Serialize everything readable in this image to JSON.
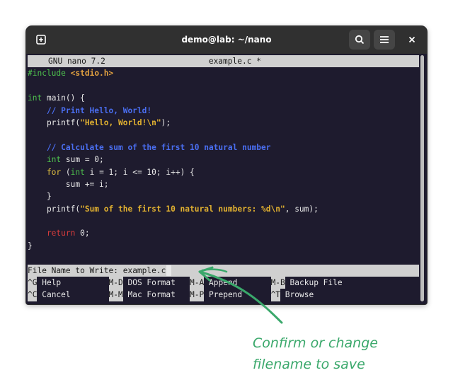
{
  "window": {
    "title": "demo@lab: ~/nano"
  },
  "header": {
    "app": "GNU nano 7.2",
    "filename": "example.c *"
  },
  "code": {
    "l1a": "#include",
    "l1b": "<stdio.h>",
    "l3a": "int",
    "l3b": " main() {",
    "l4": "    // Print Hello, World!",
    "l5a": "    printf(",
    "l5b": "\"Hello, World!\\n\"",
    "l5c": ");",
    "l7": "    // Calculate sum of the first 10 natural number",
    "l8a": "    int",
    "l8b": " sum = 0;",
    "l9a": "    for",
    "l9b": " (",
    "l9c": "int",
    "l9d": " i = 1; i <= 10; i++) {",
    "l10": "        sum += i;",
    "l11": "    }",
    "l12a": "    printf(",
    "l12b": "\"Sum of the first 10 natural numbers: %d\\n\"",
    "l12c": ", sum);",
    "l14a": "    return",
    "l14b": " 0;",
    "l15": "}"
  },
  "prompt": {
    "label": "File Name to Write: ",
    "value": "example.c"
  },
  "shortcuts": {
    "row1": [
      {
        "key": "^G",
        "label": " Help          "
      },
      {
        "key": "M-D",
        "label": " DOS Format   "
      },
      {
        "key": "M-A",
        "label": " Append       "
      },
      {
        "key": "M-B",
        "label": " Backup File"
      }
    ],
    "row2": [
      {
        "key": "^C",
        "label": " Cancel        "
      },
      {
        "key": "M-M",
        "label": " Mac Format   "
      },
      {
        "key": "M-P",
        "label": " Prepend      "
      },
      {
        "key": "^T",
        "label": " Browse"
      }
    ]
  },
  "annotation": {
    "line1": "Confirm or change",
    "line2": "filename to save"
  },
  "colors": {
    "annotation": "#3aa86b",
    "terminal_bg": "#1e1b2e"
  },
  "icons": {
    "new_tab": "plus-square-icon",
    "search": "search-icon",
    "menu": "hamburger-icon",
    "close": "close-icon"
  }
}
